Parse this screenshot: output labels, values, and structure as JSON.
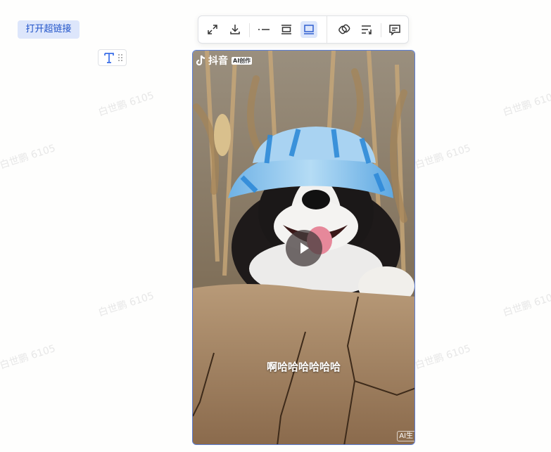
{
  "watermark": "白世鹏 6105",
  "link_button": {
    "label": "打开超链接"
  },
  "toolbar": {
    "items": [
      {
        "icon": "expand-icon"
      },
      {
        "icon": "download-icon"
      },
      {
        "icon": "inline-layout-icon"
      },
      {
        "icon": "wrap-layout-icon"
      },
      {
        "icon": "block-layout-icon",
        "active": true
      },
      {
        "icon": "link-icon"
      },
      {
        "icon": "text-wrap-icon"
      },
      {
        "icon": "comment-icon"
      }
    ]
  },
  "video": {
    "brand": "抖音",
    "brand_tag": "AI创作",
    "caption": "啊哈哈哈哈哈哈",
    "corner_label": "AI生"
  },
  "colors": {
    "accent": "#2053c9",
    "active_bg": "#dce6fb",
    "border": "#5b7fd9"
  }
}
